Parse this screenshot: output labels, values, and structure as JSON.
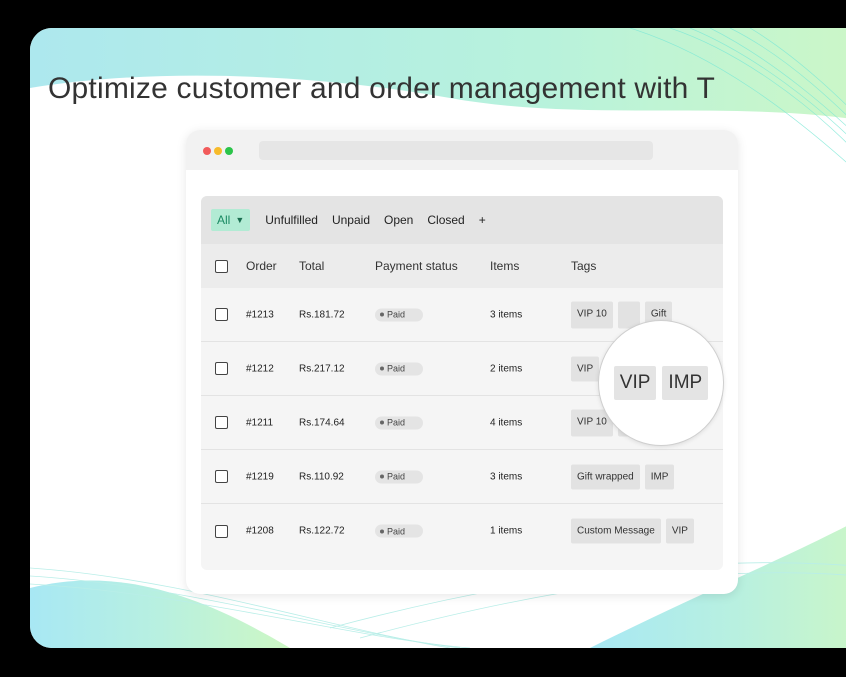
{
  "headline": "Optimize customer and order management with T",
  "window": {
    "filters": {
      "active": "All",
      "items": [
        "Unfulfilled",
        "Unpaid",
        "Open",
        "Closed",
        "+"
      ]
    },
    "columns": [
      "Order",
      "Total",
      "Payment status",
      "Items",
      "Tags"
    ],
    "rows": [
      {
        "order": "#1213",
        "total": "Rs.181.72",
        "payment": "Paid",
        "items": "3 items",
        "tags": [
          "VIP 10",
          "",
          "Gift"
        ]
      },
      {
        "order": "#1212",
        "total": "Rs.217.12",
        "payment": "Paid",
        "items": "2 items",
        "tags": [
          "VIP",
          "IMP"
        ]
      },
      {
        "order": "#1211",
        "total": "Rs.174.64",
        "payment": "Paid",
        "items": "4 items",
        "tags": [
          "VIP 10",
          "",
          ""
        ]
      },
      {
        "order": "#1219",
        "total": "Rs.110.92",
        "payment": "Paid",
        "items": "3 items",
        "tags": [
          "Gift wrapped",
          "IMP"
        ]
      },
      {
        "order": "#1208",
        "total": "Rs.122.72",
        "payment": "Paid",
        "items": "1 items",
        "tags": [
          "Custom Message",
          "VIP"
        ]
      }
    ],
    "magnifier_tags": [
      "VIP",
      "IMP"
    ]
  },
  "colors": {
    "accent": "#b2ebd4",
    "accent_text": "#1a8a63",
    "bg_cyan": "#a8eaf2",
    "bg_green": "#c9f7c4"
  }
}
